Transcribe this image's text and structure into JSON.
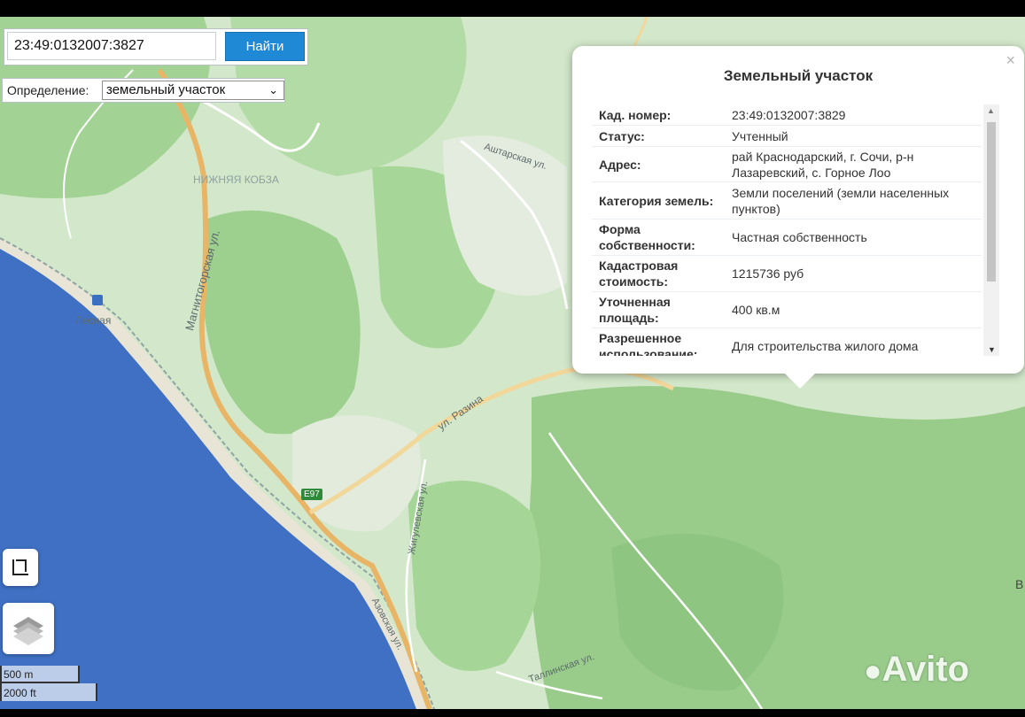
{
  "search": {
    "value": "23:49:0132007:3827",
    "button_label": "Найти"
  },
  "definition": {
    "label": "Определение:",
    "selected": "земельный участок"
  },
  "popup": {
    "title": "Земельный участок",
    "close": "×",
    "rows": [
      {
        "key": "Кад. номер:",
        "value": "23:49:0132007:3829"
      },
      {
        "key": "Статус:",
        "value": "Учтенный"
      },
      {
        "key": "Адрес:",
        "value": "рай Краснодарский, г. Сочи, р-н Лазаревский, с. Горное Лоо"
      },
      {
        "key": "Категория земель:",
        "value": "Земли поселений (земли населенных пунктов)"
      },
      {
        "key": "Форма собственности:",
        "value": "Частная собственность"
      },
      {
        "key": "Кадастровая стоимость:",
        "value": "1215736 руб"
      },
      {
        "key": "Уточненная площадь:",
        "value": "400 кв.м"
      },
      {
        "key": "Разрешенное использование:",
        "value": "Для строительства жилого дома"
      }
    ]
  },
  "map_labels": {
    "street_magnitogorskaya": "Магнитогорская ул.",
    "street_ashtarskaya": "Аштарская ул.",
    "street_razina": "ул. Разина",
    "street_zhigulevskaya": "Жигулевская ул.",
    "street_azovskaya": "Азовская ул.",
    "street_tallinskaya": "Таллинская ул.",
    "place_nizhnyaya_kobza": "НИЖНЯЯ КОБЗА",
    "station_lesnaya": "Лесная",
    "road_e97": "E97",
    "edge_letter": "В"
  },
  "scale": {
    "metric": "500 m",
    "imperial": "2000 ft"
  },
  "watermark": "Avito",
  "colors": {
    "water": "#3f70c4",
    "land": "#cfe6c6",
    "forest": "#9ccf8e",
    "road": "#e8b566",
    "button": "#1f89d6"
  }
}
